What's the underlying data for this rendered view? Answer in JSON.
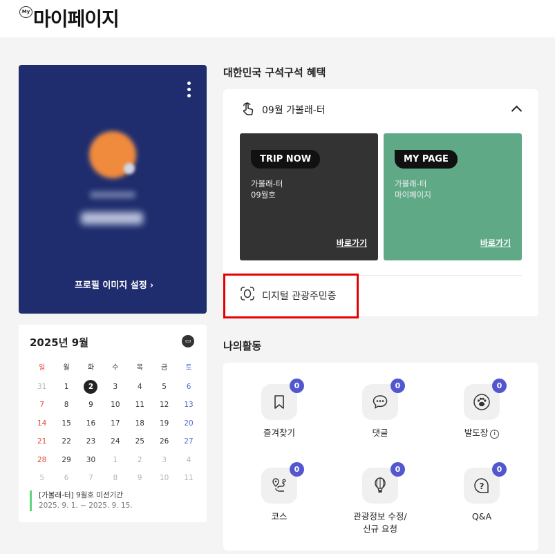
{
  "header": {
    "my_icon_text": "My",
    "title": "마이페이지"
  },
  "profile": {
    "link_label": "프로필 이미지 설정",
    "link_arrow": "›"
  },
  "calendar": {
    "title": "2025년 9월",
    "weekdays": [
      "일",
      "월",
      "화",
      "수",
      "목",
      "금",
      "토"
    ],
    "weeks": [
      [
        "31",
        "1",
        "2",
        "3",
        "4",
        "5",
        "6"
      ],
      [
        "7",
        "8",
        "9",
        "10",
        "11",
        "12",
        "13"
      ],
      [
        "14",
        "15",
        "16",
        "17",
        "18",
        "19",
        "20"
      ],
      [
        "21",
        "22",
        "23",
        "24",
        "25",
        "26",
        "27"
      ],
      [
        "28",
        "29",
        "30",
        "1",
        "2",
        "3",
        "4"
      ],
      [
        "5",
        "6",
        "7",
        "8",
        "9",
        "10",
        "11"
      ]
    ],
    "event": {
      "title": "[가볼래-터] 9월호 미션기간",
      "date": "2025. 9. 1. ~ 2025. 9. 15."
    }
  },
  "benefit": {
    "section_title": "대한민국 구석구석 혜택",
    "label": "09월 가볼래-터",
    "cards": [
      {
        "tag": "TRIP NOW",
        "line1": "가볼래-터",
        "line2": "09월호",
        "link": "바로가기"
      },
      {
        "tag": "MY PAGE",
        "line1": "가볼래-터",
        "line2": "마이페이지",
        "link": "바로가기"
      }
    ],
    "digital_id_label": "디지털 관광주민증"
  },
  "activity": {
    "section_title": "나의활동",
    "items": [
      {
        "label": "즐겨찾기",
        "count": "0",
        "icon": "bookmark-icon"
      },
      {
        "label": "댓글",
        "count": "0",
        "icon": "comment-icon"
      },
      {
        "label": "발도장",
        "count": "0",
        "icon": "footprint-icon",
        "info": "i"
      },
      {
        "label": "코스",
        "count": "0",
        "icon": "course-icon"
      },
      {
        "label": "관광정보 수정/",
        "label2": "신규 요청",
        "count": "0",
        "icon": "balloon-icon"
      },
      {
        "label": "Q&A",
        "count": "0",
        "icon": "question-icon"
      }
    ]
  },
  "colors": {
    "profile_bg": "#1f2d6e",
    "trip_card": "#333333",
    "mypage_card": "#5fa986",
    "badge": "#5257cf",
    "highlight": "#e60000"
  }
}
